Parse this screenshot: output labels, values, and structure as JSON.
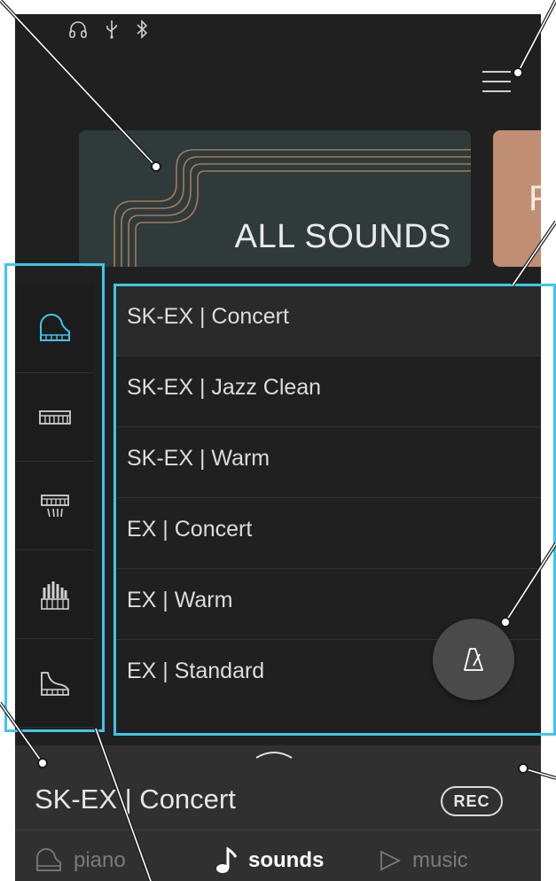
{
  "status_bar": {
    "icons": [
      "headphones-icon",
      "usb-icon",
      "bluetooth-icon"
    ]
  },
  "header": {
    "menu_icon": "hamburger-menu-icon"
  },
  "featured": {
    "all_sounds_label": "ALL SOUNDS",
    "next_card_label": "F"
  },
  "categories": [
    {
      "name": "grand-piano",
      "active": true
    },
    {
      "name": "electric-piano",
      "active": false
    },
    {
      "name": "harpsichord-mallets",
      "active": false
    },
    {
      "name": "organ",
      "active": false
    },
    {
      "name": "other-keyboard",
      "active": false
    }
  ],
  "sounds": [
    {
      "label": "SK-EX | Concert"
    },
    {
      "label": "SK-EX | Jazz Clean"
    },
    {
      "label": "SK-EX | Warm"
    },
    {
      "label": "EX | Concert"
    },
    {
      "label": "EX | Warm"
    },
    {
      "label": "EX | Standard"
    }
  ],
  "metronome": {
    "icon": "metronome-icon"
  },
  "player": {
    "current_sound": "SK-EX | Concert",
    "rec_label": "REC"
  },
  "nav": {
    "tabs": [
      {
        "label": "piano",
        "icon": "piano-icon",
        "active": false
      },
      {
        "label": "sounds",
        "icon": "music-note-icon",
        "active": true
      },
      {
        "label": "music",
        "icon": "play-outline-icon",
        "active": false
      }
    ]
  },
  "colors": {
    "accent": "#3ec6ea",
    "background": "#202020",
    "card_all_sounds": "#2f3a3b",
    "card_next": "#c08e72",
    "line_gold": "#a67a56"
  }
}
